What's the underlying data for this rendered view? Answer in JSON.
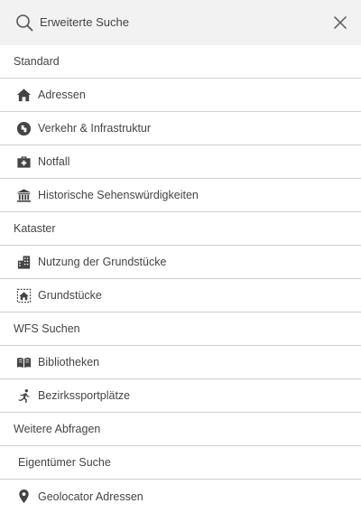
{
  "header": {
    "title": "Erweiterte Suche",
    "search_icon": "search-icon",
    "close_icon": "close-icon"
  },
  "groups": [
    {
      "heading": "Standard",
      "items": [
        {
          "label": "Adressen",
          "icon": "home-icon"
        },
        {
          "label": "Verkehr & Infrastruktur",
          "icon": "traffic-icon"
        },
        {
          "label": "Notfall",
          "icon": "first-aid-kit-icon"
        },
        {
          "label": "Historische Sehenswürdigkeiten",
          "icon": "museum-icon"
        }
      ]
    },
    {
      "heading": "Kataster",
      "items": [
        {
          "label": "Nutzung der Grundstücke",
          "icon": "building-icon"
        },
        {
          "label": "Grundstücke",
          "icon": "parcel-icon"
        }
      ]
    },
    {
      "heading": "WFS Suchen",
      "items": [
        {
          "label": "Bibliotheken",
          "icon": "book-icon"
        },
        {
          "label": "Bezirkssportplätze",
          "icon": "runner-icon"
        }
      ]
    },
    {
      "heading": "Weitere Abfragen",
      "items": [
        {
          "label": "Eigentümer Suche",
          "icon": ""
        },
        {
          "label": "Geolocator Adressen",
          "icon": "map-pin-icon"
        }
      ]
    }
  ]
}
